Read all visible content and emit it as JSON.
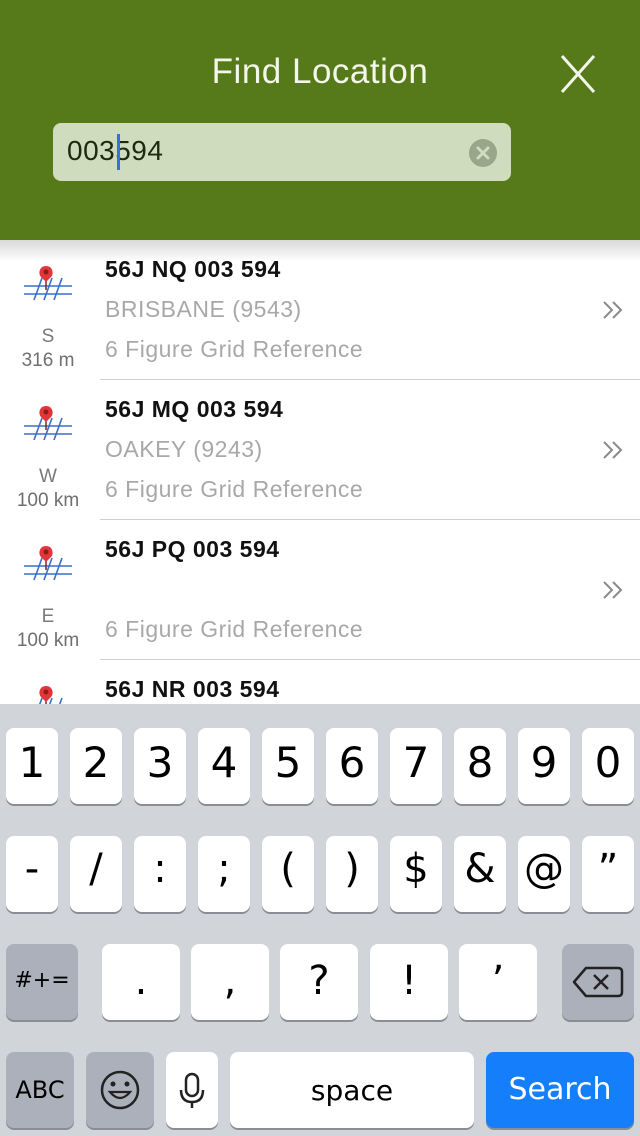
{
  "header": {
    "title": "Find Location",
    "search_value": "003594",
    "search_value_before_caret": "003",
    "search_value_after_caret": "594"
  },
  "results": [
    {
      "title": "56J NQ 003 594",
      "subtitle": "BRISBANE (9543)",
      "type": "6 Figure Grid Reference",
      "direction": "S",
      "distance": "316 m"
    },
    {
      "title": "56J MQ 003 594",
      "subtitle": "OAKEY (9243)",
      "type": "6 Figure Grid Reference",
      "direction": "W",
      "distance": "100 km"
    },
    {
      "title": "56J PQ 003 594",
      "subtitle": "",
      "type": "6 Figure Grid Reference",
      "direction": "E",
      "distance": "100 km"
    },
    {
      "title": "56J NR 003 594",
      "subtitle": "",
      "type": "",
      "direction": "",
      "distance": ""
    }
  ],
  "keyboard": {
    "row1": [
      "1",
      "2",
      "3",
      "4",
      "5",
      "6",
      "7",
      "8",
      "9",
      "0"
    ],
    "row2": [
      "-",
      "/",
      ":",
      ";",
      "(",
      ")",
      "$",
      "&",
      "@",
      "”"
    ],
    "row3_left": "#+=",
    "row3": [
      ".",
      ",",
      "?",
      "!",
      "’"
    ],
    "abc": "ABC",
    "space": "space",
    "search": "Search"
  },
  "colors": {
    "header_bg": "#567a1a",
    "search_key": "#157efb",
    "keyboard_bg": "#d1d4d9"
  }
}
